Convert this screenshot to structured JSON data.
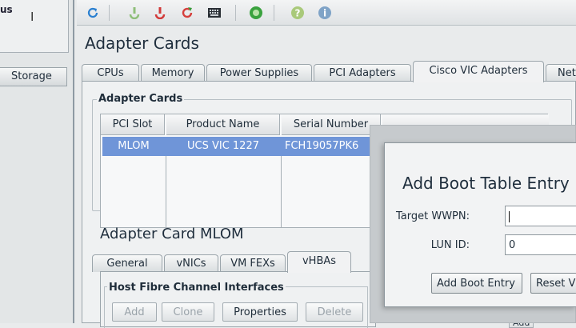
{
  "left": {
    "status_label": "us",
    "storage_tab": "Storage"
  },
  "toolbar": {
    "icons": [
      "refresh-icon",
      "power-on-icon",
      "power-off-icon",
      "reset-icon",
      "kvm-console-icon",
      "globe-icon",
      "help-icon",
      "info-icon"
    ]
  },
  "page": {
    "title": "Adapter Cards"
  },
  "tabs": [
    {
      "label": "CPUs"
    },
    {
      "label": "Memory"
    },
    {
      "label": "Power Supplies"
    },
    {
      "label": "PCI Adapters"
    },
    {
      "label": "Cisco VIC Adapters"
    },
    {
      "label": "Net"
    }
  ],
  "adapter_cards": {
    "group_label": "Adapter Cards",
    "columns": [
      "PCI Slot",
      "Product Name",
      "Serial Number"
    ],
    "rows": [
      {
        "pci_slot": "MLOM",
        "product_name": "UCS VIC 1227",
        "serial_number": "FCH19057PK6"
      }
    ]
  },
  "adapter_card": {
    "title": "Adapter Card MLOM",
    "subtabs": [
      {
        "label": "General"
      },
      {
        "label": "vNICs"
      },
      {
        "label": "VM FEXs"
      },
      {
        "label": "vHBAs"
      }
    ],
    "hfc_label": "Host Fibre Channel Interfaces",
    "buttons": {
      "add": "Add",
      "clone": "Clone",
      "properties": "Properties",
      "delete": "Delete"
    }
  },
  "dialog": {
    "title": "Add Boot Table Entry",
    "target_wwpn_label": "Target WWPN:",
    "target_wwpn_value": "",
    "lun_id_label": "LUN ID:",
    "lun_id_value": "0",
    "add_button": "Add Boot Entry",
    "reset_button": "Reset V"
  },
  "peek_buttons": {
    "add": "Add"
  },
  "colors": {
    "selection": "#6f95d8",
    "accent": "#1f2e3d"
  }
}
